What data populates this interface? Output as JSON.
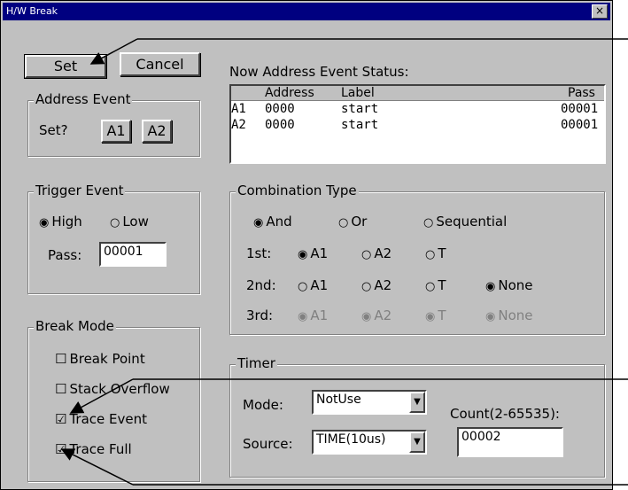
{
  "window": {
    "title": "H/W Break",
    "close_glyph": "×"
  },
  "buttons": {
    "set": "Set",
    "cancel": "Cancel"
  },
  "address_event": {
    "group_title": "Address Event",
    "set_label": "Set?",
    "a1": "A1",
    "a2": "A2"
  },
  "status": {
    "title": "Now Address Event Status:",
    "headers": {
      "address": "Address",
      "label": "Label",
      "pass": "Pass"
    },
    "rows": [
      {
        "name": "A1",
        "address": "0000",
        "label": "start",
        "pass": "00001"
      },
      {
        "name": "A2",
        "address": "0000",
        "label": "start",
        "pass": "00001"
      }
    ]
  },
  "trigger_event": {
    "group_title": "Trigger Event",
    "high": "High",
    "low": "Low",
    "selected": "High",
    "pass_label": "Pass:",
    "pass_value": "00001"
  },
  "combination": {
    "group_title": "Combination Type",
    "and": "And",
    "or": "Or",
    "sequential": "Sequential",
    "selected": "And",
    "row1_label": "1st:",
    "row2_label": "2nd:",
    "row3_label": "3rd:",
    "opt_a1": "A1",
    "opt_a2": "A2",
    "opt_t": "T",
    "opt_none": "None",
    "row1_selected": "A1",
    "row2_selected": "None",
    "row3_selected": "disabled"
  },
  "break_mode": {
    "group_title": "Break Mode",
    "items": [
      {
        "label": "Break Point",
        "checked": false
      },
      {
        "label": "Stack Overflow",
        "checked": false
      },
      {
        "label": "Trace Event",
        "checked": true
      },
      {
        "label": "Trace Full",
        "checked": true
      }
    ]
  },
  "timer": {
    "group_title": "Timer",
    "mode_label": "Mode:",
    "mode_value": "NotUse",
    "source_label": "Source:",
    "source_value": "TIME(10us)",
    "count_label": "Count(2-65535):",
    "count_value": "00002"
  },
  "icons": {
    "radio_on": "◉",
    "radio_off": "○",
    "check_on": "☑",
    "check_off": "☐",
    "dropdown": "▼"
  }
}
